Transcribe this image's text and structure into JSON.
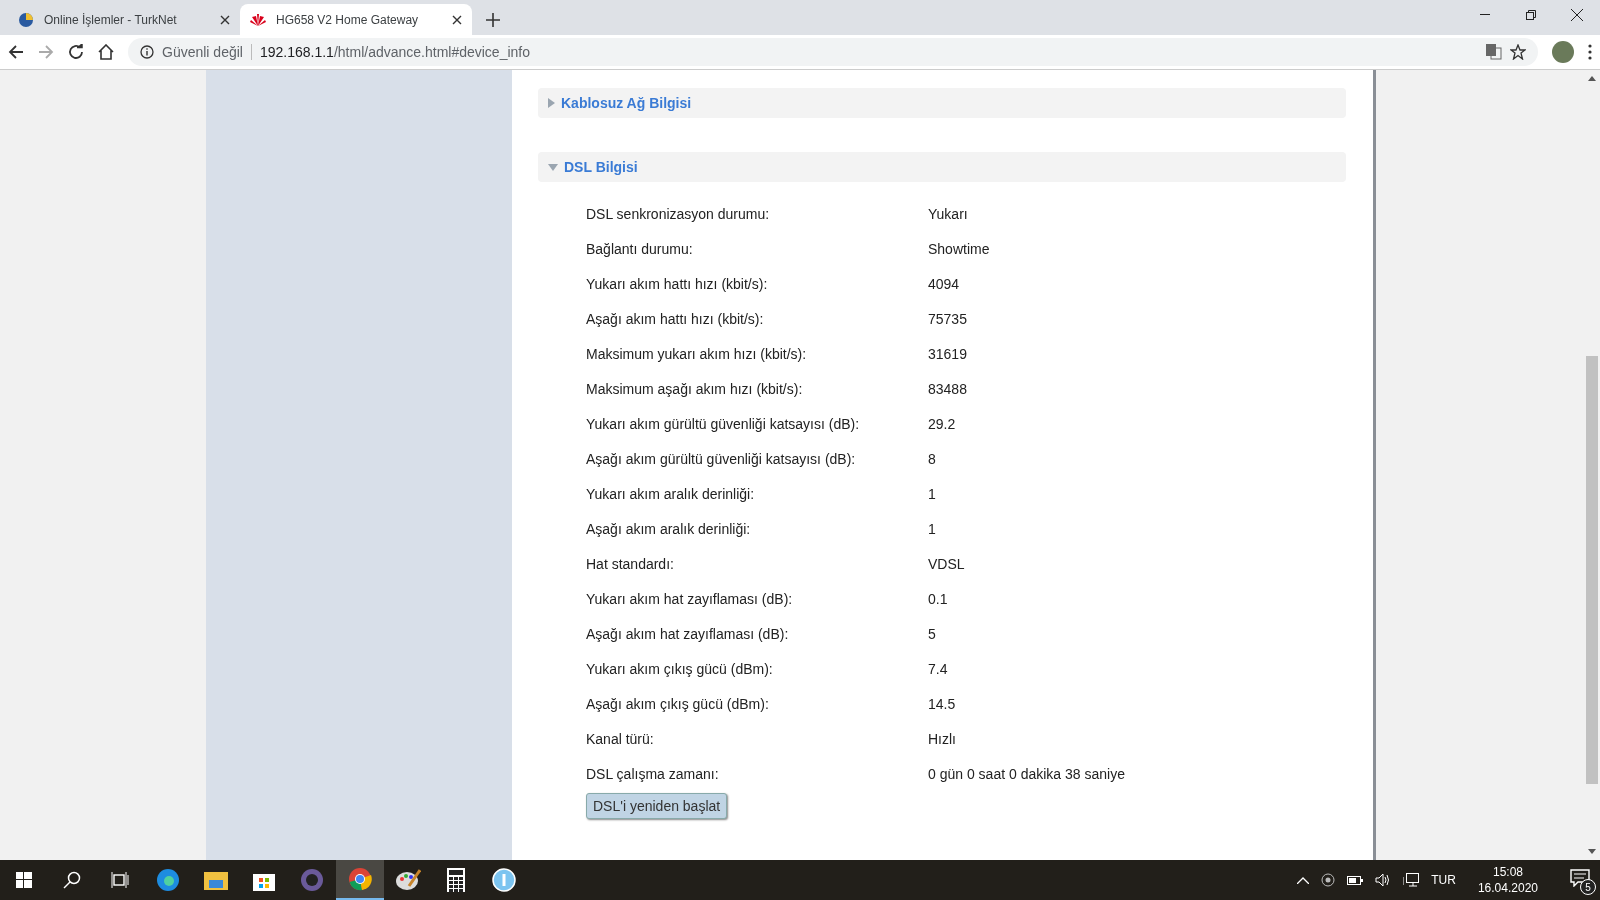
{
  "tabs": [
    {
      "title": "Online İşlemler - TurkNet",
      "selected": false
    },
    {
      "title": "HG658 V2 Home Gateway",
      "selected": true
    }
  ],
  "address_bar": {
    "security": "Güvenli değil",
    "host": "192.168.1.1",
    "path": "/html/advance.html#device_info"
  },
  "sections": [
    {
      "title": "Kablosuz Ağ Bilgisi",
      "expanded": false
    },
    {
      "title": "DSL Bilgisi",
      "expanded": true
    }
  ],
  "dsl_rows": [
    {
      "label": "DSL senkronizasyon durumu:",
      "value": "Yukarı"
    },
    {
      "label": "Bağlantı durumu:",
      "value": "Showtime"
    },
    {
      "label": "Yukarı akım hattı hızı (kbit/s):",
      "value": "4094"
    },
    {
      "label": "Aşağı akım hattı hızı (kbit/s):",
      "value": "75735"
    },
    {
      "label": "Maksimum yukarı akım hızı (kbit/s):",
      "value": "31619"
    },
    {
      "label": "Maksimum aşağı akım hızı (kbit/s):",
      "value": "83488"
    },
    {
      "label": "Yukarı akım gürültü güvenliği katsayısı (dB):",
      "value": "29.2"
    },
    {
      "label": "Aşağı akım gürültü güvenliği katsayısı (dB):",
      "value": "8"
    },
    {
      "label": "Yukarı akım aralık derinliği:",
      "value": "1"
    },
    {
      "label": "Aşağı akım aralık derinliği:",
      "value": "1"
    },
    {
      "label": "Hat standardı:",
      "value": "VDSL"
    },
    {
      "label": "Yukarı akım hat zayıflaması (dB):",
      "value": "0.1"
    },
    {
      "label": "Aşağı akım hat zayıflaması (dB):",
      "value": "5"
    },
    {
      "label": "Yukarı akım çıkış gücü (dBm):",
      "value": "7.4"
    },
    {
      "label": "Aşağı akım çıkış gücü (dBm):",
      "value": "14.5"
    },
    {
      "label": "Kanal türü:",
      "value": "Hızlı"
    },
    {
      "label": "DSL çalışma zamanı:",
      "value": "0 gün 0 saat 0 dakika 38 saniye"
    }
  ],
  "restart_button": "DSL'i yeniden başlat",
  "taskbar": {
    "apps": [
      {
        "kind": "edge",
        "selected": false
      },
      {
        "kind": "explorer",
        "selected": false
      },
      {
        "kind": "store",
        "selected": false
      },
      {
        "kind": "orb",
        "selected": false
      },
      {
        "kind": "chrome",
        "selected": true
      },
      {
        "kind": "paint",
        "selected": false
      },
      {
        "kind": "calculator",
        "selected": false
      },
      {
        "kind": "info",
        "selected": false
      }
    ],
    "language": "TUR",
    "time": "15:08",
    "date": "16.04.2020",
    "notifications": "5"
  }
}
